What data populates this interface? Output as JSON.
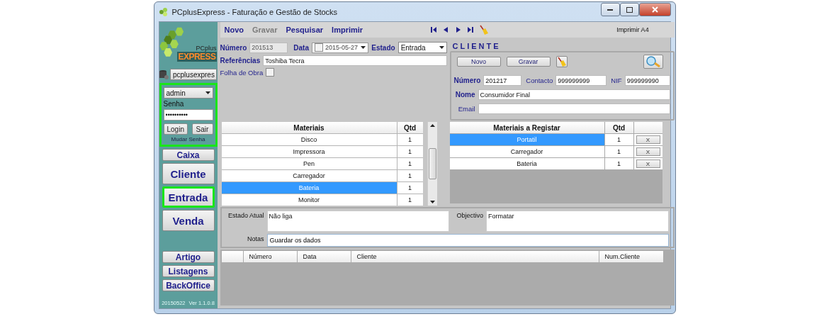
{
  "window": {
    "title": "PCplusExpress - Faturação e Gestão de Stocks"
  },
  "sidebar": {
    "logo_text": "PCplus",
    "logo_brand": "EXPRESS",
    "database": "pcplusexpres",
    "login": {
      "user": "admin",
      "password_label": "Senha",
      "password": "••••••••••",
      "buttons": [
        "Login",
        "Sair"
      ],
      "change_password": "Mudar Senha",
      "highlighted": true
    },
    "nav": [
      {
        "label": "Caixa",
        "kind": "small",
        "highlighted": false
      },
      {
        "label": "Cliente",
        "kind": "large",
        "highlighted": false
      },
      {
        "label": "Entrada",
        "kind": "large",
        "highlighted": true
      },
      {
        "label": "Venda",
        "kind": "large",
        "highlighted": false
      }
    ],
    "nav_bottom": [
      {
        "label": "Artigo",
        "highlighted": false
      },
      {
        "label": "Listagens",
        "highlighted": false
      },
      {
        "label": "BackOffice",
        "highlighted": false
      }
    ],
    "version": [
      "20150522",
      "Ver 1.1.0.8"
    ]
  },
  "toolbar": {
    "actions": [
      {
        "label": "Novo",
        "disabled": false
      },
      {
        "label": "Gravar",
        "disabled": true
      },
      {
        "label": "Pesquisar",
        "disabled": false
      },
      {
        "label": "Imprimir",
        "disabled": false
      }
    ],
    "print_format": "Imprimir A4"
  },
  "form": {
    "numero": {
      "label": "Número",
      "value": "201513"
    },
    "data": {
      "label": "Data",
      "value": "2015-05-27",
      "checked": false
    },
    "estado": {
      "label": "Estado",
      "value": "Entrada"
    },
    "referencias": {
      "label": "Referências",
      "value": "Toshiba Tecra"
    },
    "folha_de_obra": {
      "label": "Folha de Obra",
      "checked": false
    }
  },
  "cliente": {
    "title": "CLIENTE",
    "buttons": [
      "Novo",
      "Gravar"
    ],
    "fields": [
      {
        "label": "Número",
        "value": "201217"
      },
      {
        "label": "Contacto",
        "value": "999999999"
      },
      {
        "label": "NIF",
        "value": "999999990"
      },
      {
        "label": "Nome",
        "value": "Consumidor Final"
      },
      {
        "label": "Email"
      }
    ]
  },
  "materials": {
    "columns": [
      "Materiais",
      "Qtd"
    ],
    "rows": [
      {
        "name": "Disco",
        "qty": "1",
        "selected": false
      },
      {
        "name": "Impressora",
        "qty": "1",
        "selected": false
      },
      {
        "name": "Pen",
        "qty": "1",
        "selected": false
      },
      {
        "name": "Carregador",
        "qty": "1",
        "selected": false
      },
      {
        "name": "Bateria",
        "qty": "1",
        "selected": true
      },
      {
        "name": "Monitor",
        "qty": "1",
        "selected": false
      }
    ]
  },
  "registar": {
    "columns": [
      "Materiais a Registar",
      "Qtd"
    ],
    "rows": [
      {
        "name": "Portatil",
        "qty": "1",
        "selected": true,
        "remove": "X"
      },
      {
        "name": "Carregador",
        "qty": "1",
        "selected": false,
        "remove": "X"
      },
      {
        "name": "Bateria",
        "qty": "1",
        "selected": false,
        "remove": "X"
      }
    ]
  },
  "notes": {
    "estado_atual": {
      "label": "Estado Atual",
      "value": "Não liga"
    },
    "objectivo": {
      "label": "Objectivo",
      "value": "Formatar"
    },
    "notas": {
      "label": "Notas",
      "value": "Guardar os dados"
    }
  },
  "list": {
    "columns": [
      "Número",
      "Data",
      "Cliente",
      "Num.Cliente"
    ]
  }
}
